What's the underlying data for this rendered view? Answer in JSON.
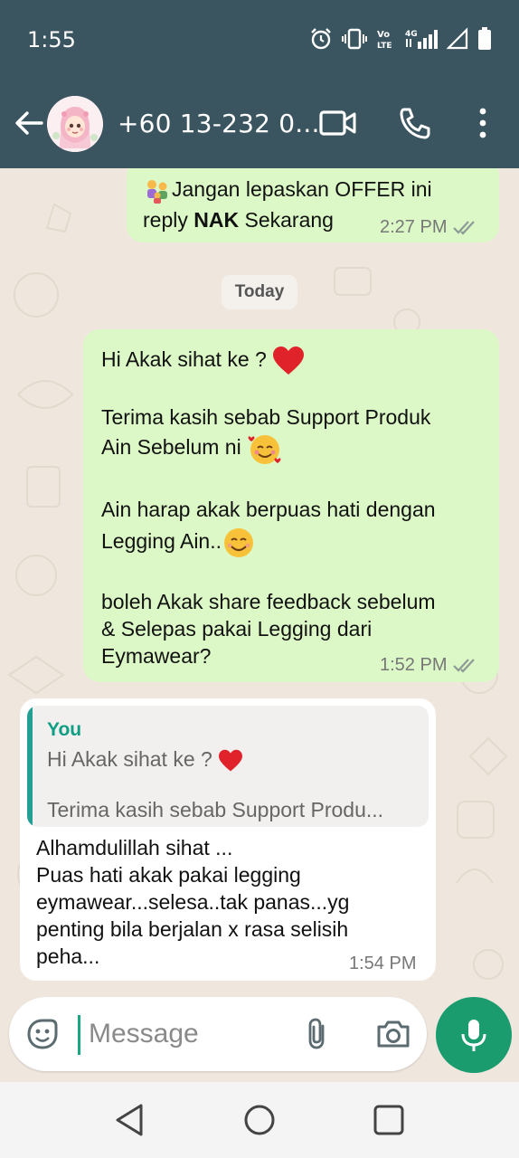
{
  "status_bar": {
    "time": "1:55",
    "icons": [
      "alarm-icon",
      "vibrate-icon",
      "volte-icon",
      "4g-signal-icon",
      "wifi-signal-icon",
      "battery-icon"
    ],
    "volte_label": "Vo LTE",
    "network_label": "4G"
  },
  "header": {
    "contact_name": "+60 13-232 0...",
    "icons": [
      "back-arrow-icon",
      "video-call-icon",
      "phone-call-icon",
      "more-options-icon"
    ]
  },
  "chat": {
    "messages": [
      {
        "direction": "outgoing",
        "line1": "Jangan lepaskan OFFER  ini",
        "line2_prefix": "reply  ",
        "line2_bold": "NAK",
        "line2_suffix": " Sekarang",
        "time": "2:27 PM",
        "status": "read"
      },
      {
        "direction": "outgoing",
        "line1": "Hi Akak sihat ke ? ",
        "line2": "Terima kasih sebab Support Produk",
        "line3": "Ain Sebelum ni ",
        "line4": "Ain harap akak berpuas hati dengan",
        "line5": "Legging Ain..",
        "line6": "boleh Akak share feedback sebelum",
        "line7": "& Selepas pakai Legging dari",
        "line8": "Eymawear?",
        "time": "1:52 PM",
        "status": "read"
      },
      {
        "direction": "incoming",
        "quote_author": "You",
        "quote_line1": "Hi Akak sihat ke ? ",
        "quote_line2": "Terima kasih sebab Support Produ...",
        "line1": "Alhamdulillah sihat ...",
        "line2": "Puas hati akak pakai legging",
        "line3": "eymawear...selesa..tak panas...yg",
        "line4": "penting bila berjalan x rasa selisih",
        "line5": "peha...",
        "time": "1:54 PM"
      }
    ],
    "day_divider": "Today"
  },
  "composer": {
    "placeholder": "Message",
    "icons": [
      "sticker-icon",
      "attach-icon",
      "camera-icon",
      "mic-icon"
    ]
  },
  "colors": {
    "header_bg": "#3b5560",
    "outgoing_bubble": "#dcf8c6",
    "incoming_bubble": "#ffffff",
    "accent_green": "#1a9c6f",
    "chat_bg": "#efe7de"
  }
}
